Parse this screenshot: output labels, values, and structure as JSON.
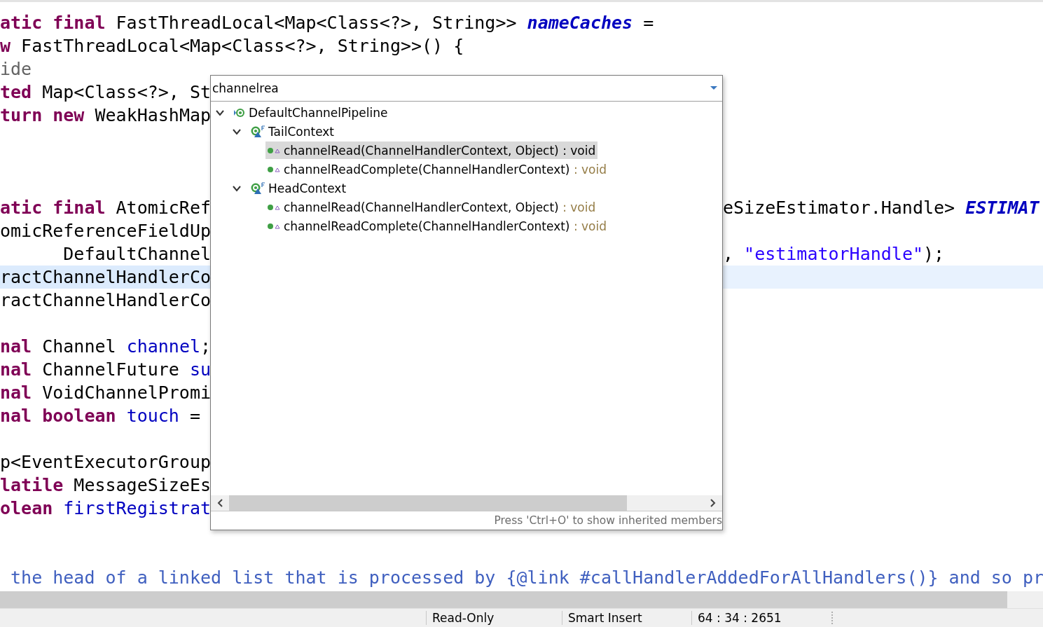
{
  "editor": {
    "lines": [
      {
        "current": false,
        "left": [
          {
            "kind": "keyword",
            "text": "atic final"
          },
          {
            "kind": "plain",
            "text": " FastThreadLocal<Map<Class<?>, String>> "
          },
          {
            "kind": "static-field",
            "text": "nameCaches"
          },
          {
            "kind": "plain",
            "text": " ="
          }
        ]
      },
      {
        "current": false,
        "left": [
          {
            "kind": "keyword",
            "text": "w"
          },
          {
            "kind": "plain",
            "text": " FastThreadLocal<Map<Class<?>, String>>() {"
          }
        ]
      },
      {
        "current": false,
        "left": [
          {
            "kind": "annotation",
            "text": "ide"
          }
        ]
      },
      {
        "current": false,
        "left": [
          {
            "kind": "keyword",
            "text": "ted"
          },
          {
            "kind": "plain",
            "text": " Map<Class<?>, St"
          }
        ]
      },
      {
        "current": false,
        "left": [
          {
            "kind": "keyword",
            "text": "turn new"
          },
          {
            "kind": "plain",
            "text": " WeakHashMap"
          }
        ]
      },
      {
        "current": false
      },
      {
        "current": false
      },
      {
        "current": false
      },
      {
        "current": false,
        "left": [
          {
            "kind": "keyword",
            "text": "atic final"
          },
          {
            "kind": "plain",
            "text": " AtomicRef"
          }
        ],
        "right": [
          {
            "kind": "plain",
            "text": "eSizeEstimator.Handle> "
          },
          {
            "kind": "static-field",
            "text": "ESTIMAT"
          }
        ]
      },
      {
        "current": false,
        "left": [
          {
            "kind": "plain",
            "text": "omicReferenceFieldUp"
          }
        ]
      },
      {
        "current": false,
        "left": [
          {
            "kind": "plain",
            "text": "      DefaultChannel"
          }
        ],
        "right": [
          {
            "kind": "plain",
            "text": ", "
          },
          {
            "kind": "string",
            "text": "\"estimatorHandle\""
          },
          {
            "kind": "plain",
            "text": ");"
          }
        ]
      },
      {
        "current": true,
        "left": [
          {
            "kind": "plain",
            "text": "ractChannelHandlerCo"
          }
        ]
      },
      {
        "current": false,
        "left": [
          {
            "kind": "plain",
            "text": "ractChannelHandlerCo"
          }
        ]
      },
      {
        "current": false
      },
      {
        "current": false,
        "left": [
          {
            "kind": "keyword",
            "text": "nal"
          },
          {
            "kind": "plain",
            "text": " Channel "
          },
          {
            "kind": "field",
            "text": "channel"
          },
          {
            "kind": "plain",
            "text": ";"
          }
        ]
      },
      {
        "current": false,
        "left": [
          {
            "kind": "keyword",
            "text": "nal"
          },
          {
            "kind": "plain",
            "text": " ChannelFuture "
          },
          {
            "kind": "field",
            "text": "su"
          }
        ]
      },
      {
        "current": false,
        "left": [
          {
            "kind": "keyword",
            "text": "nal"
          },
          {
            "kind": "plain",
            "text": " VoidChannelPromi"
          }
        ]
      },
      {
        "current": false,
        "left": [
          {
            "kind": "keyword",
            "text": "nal boolean "
          },
          {
            "kind": "field",
            "text": "touch"
          },
          {
            "kind": "plain",
            "text": " ="
          }
        ]
      },
      {
        "current": false
      },
      {
        "current": false,
        "left": [
          {
            "kind": "plain",
            "text": "p<EventExecutorGroup"
          }
        ]
      },
      {
        "current": false,
        "left": [
          {
            "kind": "keyword",
            "text": "latile"
          },
          {
            "kind": "plain",
            "text": " MessageSizeEs"
          }
        ]
      },
      {
        "current": false,
        "left": [
          {
            "kind": "keyword",
            "text": "olean "
          },
          {
            "kind": "field",
            "text": "firstRegistrat"
          }
        ]
      },
      {
        "current": false
      },
      {
        "current": false
      },
      {
        "current": false,
        "left": [
          {
            "kind": "javadoc",
            "text": " the head of a linked list that is processed by {@link #callHandlerAddedForAllHandlers()} and so pr"
          }
        ]
      }
    ]
  },
  "outline_popup": {
    "filter": {
      "value": "channelrea"
    },
    "tree": [
      {
        "kind": "class",
        "label": "DefaultChannelPipeline",
        "expanded": true,
        "selected": false,
        "children": [
          {
            "kind": "inner-class",
            "label": "TailContext",
            "expanded": true,
            "selected": false,
            "children": [
              {
                "kind": "method",
                "label": "channelRead(ChannelHandlerContext, Object)",
                "return_type": " : void",
                "selected": true
              },
              {
                "kind": "method",
                "label": "channelReadComplete(ChannelHandlerContext)",
                "return_type": " : void",
                "selected": false
              }
            ]
          },
          {
            "kind": "inner-class",
            "label": "HeadContext",
            "expanded": true,
            "selected": false,
            "children": [
              {
                "kind": "method",
                "label": "channelRead(ChannelHandlerContext, Object)",
                "return_type": " : void",
                "selected": false
              },
              {
                "kind": "method",
                "label": "channelReadComplete(ChannelHandlerContext)",
                "return_type": " : void",
                "selected": false
              }
            ]
          }
        ]
      }
    ],
    "footer": "Press 'Ctrl+O' to show inherited members"
  },
  "status_bar": [
    "Read-Only",
    "Smart Insert",
    "64 : 34 : 2651"
  ]
}
